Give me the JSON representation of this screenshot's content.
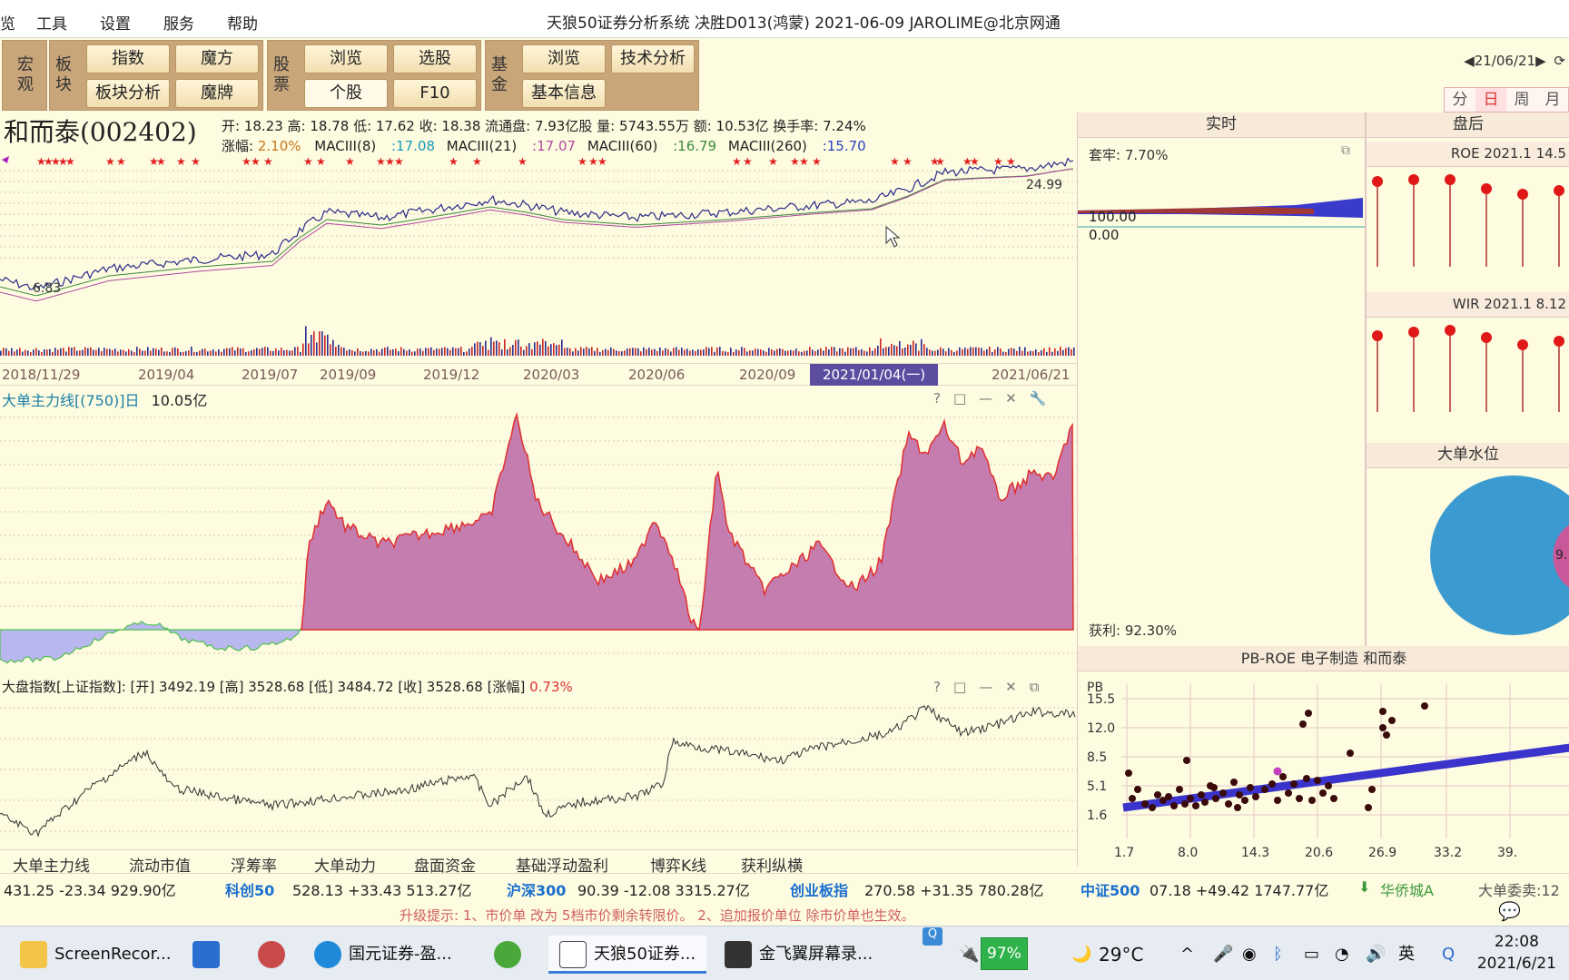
{
  "menu": {
    "items": [
      "工具",
      "设置",
      "服务",
      "帮助"
    ],
    "title": "天狼50证券分析系统  决胜D013(鸿蒙)  2021-06-09 JAROLIME@北京网通"
  },
  "toolbar": {
    "macro_label": "宏观",
    "block_label": "板块",
    "index_btn": "指数",
    "magic_btn": "魔方",
    "block_analysis_btn": "板块分析",
    "magic_card_btn": "魔牌",
    "stock_label": "股票",
    "browse_btn": "浏览",
    "pick_btn": "选股",
    "single_btn": "个股",
    "f10_btn": "F10",
    "fund_label": "基金",
    "fund_browse_btn": "浏览",
    "tech_btn": "技术分析",
    "basic_info_btn": "基本信息",
    "date_nav": "◀21/06/21▶",
    "periods": [
      "分",
      "日",
      "周",
      "月"
    ]
  },
  "stock": {
    "name": "和而泰(002402)",
    "quotes": "开: 18.23  高: 18.78  低: 17.62  收: 18.38  流通盘: 7.93亿股  量: 5743.55万  额: 10.53亿  换手率: 7.24%",
    "change_label": "涨幅:",
    "change_value": "2.10%",
    "maciii8_label": "MACIII(8)",
    "maciii8": ":17.08",
    "maciii21_label": "MACIII(21)",
    "maciii21": ":17.07",
    "maciii60_label": "MACIII(60)",
    "maciii60": ":16.79",
    "maciii260_label": "MACIII(260)",
    "maciii260": ":15.70",
    "price_high_label": "24.99",
    "price_low_label": "6.83"
  },
  "dates": [
    "2018/11/29",
    "2019/04",
    "2019/07",
    "2019/09",
    "2019/12",
    "2020/03",
    "2020/06",
    "2020/09",
    "2021/01/04(一)",
    "2021/06/21"
  ],
  "big_order": {
    "title": "大单主力线[(750)]日",
    "value": "10.05亿"
  },
  "market": {
    "title": "大盘指数[上证指数]: [开] 3492.19 [高] 3528.68 [低] 3484.72 [收] 3528.68 [涨幅]",
    "change": "0.73%"
  },
  "realtime": {
    "header": "实时",
    "trapped": "套牢: 7.70%",
    "level_100": "100.00",
    "level_0": "0.00",
    "profit": "获利: 92.30%"
  },
  "after_hours": {
    "header": "盘后",
    "roe_title": "ROE 2021.1 14.5",
    "wir_title": "WIR 2021.1 8.12",
    "water_title": "大单水位",
    "water_value": "9."
  },
  "pb_roe": {
    "title": "PB-ROE 电子制造  和而泰",
    "y_label": "PB",
    "y_ticks": [
      "15.5",
      "12.0",
      "8.5",
      "5.1",
      "1.6"
    ],
    "x_ticks": [
      "1.7",
      "8.0",
      "14.3",
      "20.6",
      "26.9",
      "33.2",
      "39."
    ]
  },
  "tabs": [
    "大单主力线",
    "流动市值",
    "浮筹率",
    "大单动力",
    "盘面资金",
    "基础浮动盈利",
    "博弈K线",
    "获利纵横"
  ],
  "ticker": {
    "t1": "431.25  -23.34  929.90亿",
    "n2": "科创50",
    "t2": "528.13  +33.43  513.27亿",
    "n3": "沪深300",
    "t3": "90.39  -12.08  3315.27亿",
    "n4": "创业板指",
    "t4": "270.58  +31.35  780.28亿",
    "n5": "中证500",
    "t5": "07.18  +49.42  1747.77亿",
    "t6": "华侨城A",
    "t7": "大单委卖:12"
  },
  "tip": "升级提示: 1、市价单 改为 5档市价剩余转限价。 2、追加报价单位 除市价单也生效。",
  "taskbar": {
    "apps": [
      "ScreenRecor...",
      "国元证券-盈...",
      "天狼50证券...",
      "金飞翼屏幕录..."
    ],
    "battery": "97%",
    "weather": "29°C",
    "time": "22:08",
    "date": "2021/6/21"
  },
  "colors": {
    "accent": "#5b4c9f",
    "area_fill": "#c47dae",
    "area_line": "#e03030",
    "negative_fill": "#b9b8ee",
    "scatter_line": "#3a34cc"
  }
}
